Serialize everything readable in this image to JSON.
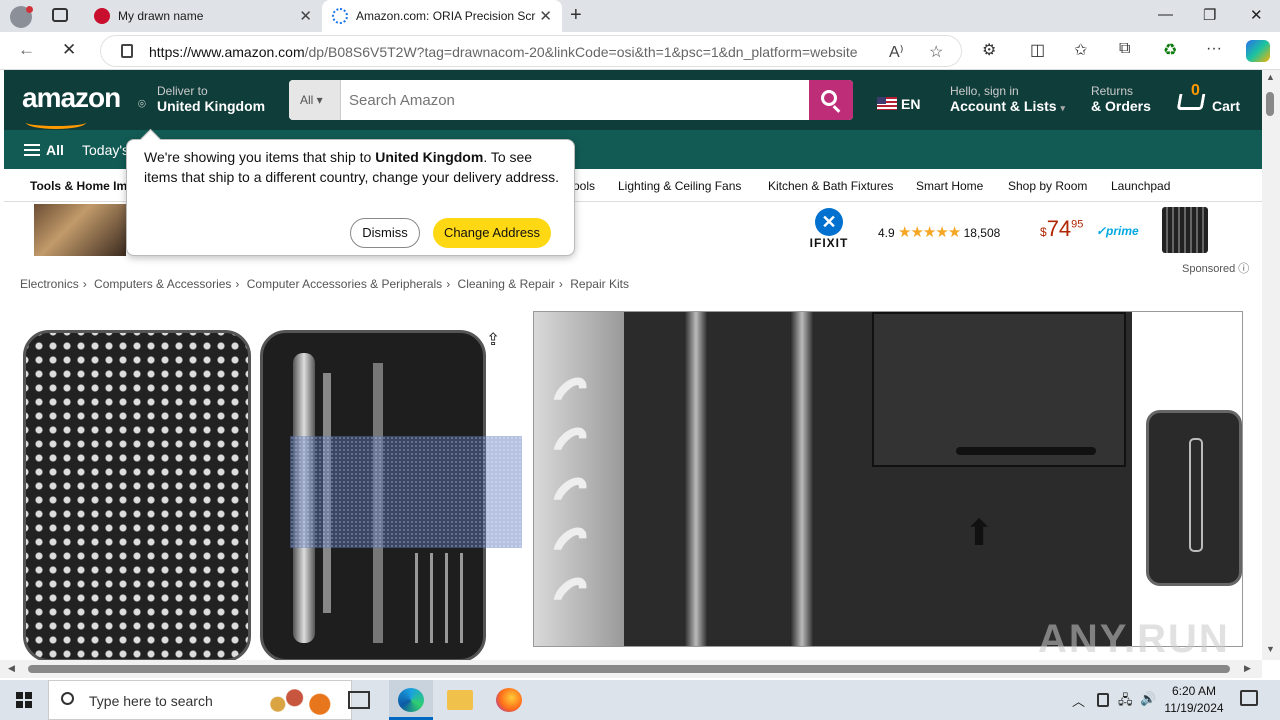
{
  "browser": {
    "tabs": [
      {
        "title": "My drawn name",
        "close": "✕"
      },
      {
        "title": "Amazon.com: ORIA Precision Scr",
        "close": "✕"
      }
    ],
    "new_tab": "+",
    "window": {
      "minimize": "—",
      "maximize": "❐",
      "close": "✕"
    },
    "url_host": "https://www.amazon.com",
    "url_path": "/dp/B08S6V5T2W?tag=drawnacom-20&linkCode=osi&th=1&psc=1&dn_platform=website",
    "nav": {
      "back": "←",
      "reload": "✕"
    },
    "url_icons": {
      "read_aloud": "A⁾",
      "favorite": "☆"
    },
    "toolbar": {
      "extensions": "⚙",
      "split": "◫",
      "favorites": "✩",
      "collections": "⧉",
      "performance": "♻",
      "more": "···"
    }
  },
  "amazon": {
    "logo": "amazon",
    "deliver_to_label": "Deliver to",
    "deliver_to_location": "United Kingdom",
    "search": {
      "category": "All",
      "placeholder": "Search Amazon"
    },
    "language": "EN",
    "account": {
      "greeting": "Hello, sign in",
      "label": "Account & Lists"
    },
    "returns": {
      "line1": "Returns",
      "line2": "& Orders"
    },
    "cart": {
      "count": "0",
      "label": "Cart"
    },
    "nav2": {
      "all": "All",
      "today": "Today's"
    },
    "subnav": [
      "Tools & Home Im",
      "ools",
      "Lighting & Ceiling Fans",
      "Kitchen & Bath Fixtures",
      "Smart Home",
      "Shop by Room",
      "Launchpad"
    ],
    "ad": {
      "brand": "IFIXIT",
      "rating": "4.9",
      "stars": "★★★★★",
      "reviews": "18,508",
      "price_symbol": "$",
      "price_whole": "74",
      "price_cents": "95",
      "prime": "✓prime"
    },
    "sponsored": "Sponsored ⓘ",
    "breadcrumb": [
      "Electronics",
      "Computers & Accessories",
      "Computer Accessories & Peripherals",
      "Cleaning & Repair",
      "Repair Kits"
    ],
    "breadcrumb_sep": "›",
    "share_icon": "⇪",
    "popup": {
      "msg_start": "We're showing you items that ship to ",
      "msg_bold": "United Kingdom",
      "msg_end": ". To see items that ship to a different country, change your delivery address.",
      "dismiss": "Dismiss",
      "change": "Change Address"
    },
    "watermark": "ANY.RUN"
  },
  "taskbar": {
    "search_placeholder": "Type here to search",
    "time": "6:20 AM",
    "date": "11/19/2024",
    "tray": {
      "chevron": "︿",
      "network": "🖧",
      "volume": "🔊"
    }
  }
}
